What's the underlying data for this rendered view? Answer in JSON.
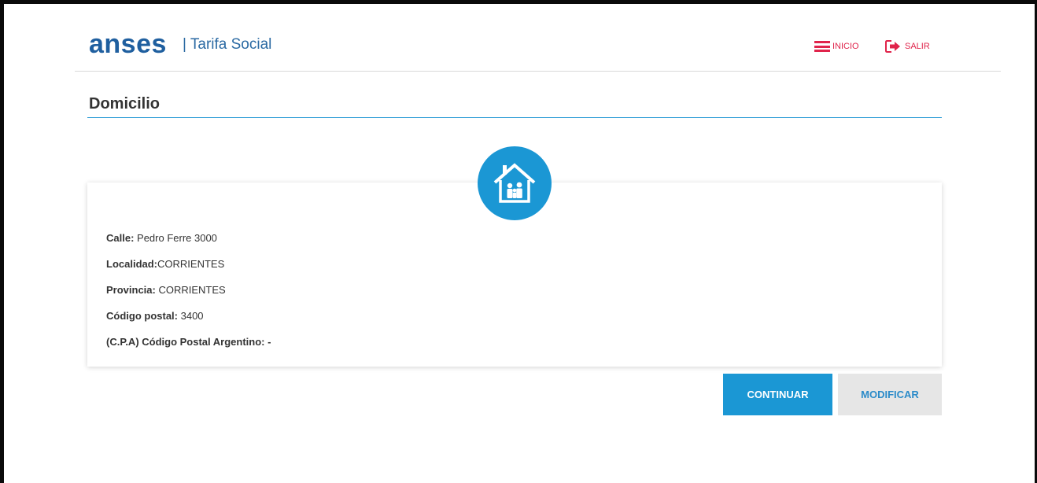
{
  "header": {
    "logo_text": "anses",
    "product_label": "| Tarifa Social",
    "nav": {
      "inicio_label": "INICIO",
      "salir_label": "SALIR"
    }
  },
  "section": {
    "title": "Domicilio"
  },
  "card": {
    "icon": "house-family-icon",
    "fields": [
      {
        "label": "Calle:",
        "value": " Pedro Ferre 3000"
      },
      {
        "label": "Localidad:",
        "value": "CORRIENTES"
      },
      {
        "label": "Provincia:",
        "value": " CORRIENTES"
      },
      {
        "label": "Código postal:",
        "value": " 3400"
      },
      {
        "label": "(C.P.A) Código Postal Argentino:",
        "value": " -"
      }
    ]
  },
  "actions": {
    "continuar_label": "CONTINUAR",
    "modificar_label": "MODIFICAR"
  },
  "colors": {
    "brand_blue": "#1f5f9f",
    "accent_blue": "#1b97d4",
    "nav_red": "#e0244b",
    "secondary_button_bg": "#e6e6e6"
  }
}
